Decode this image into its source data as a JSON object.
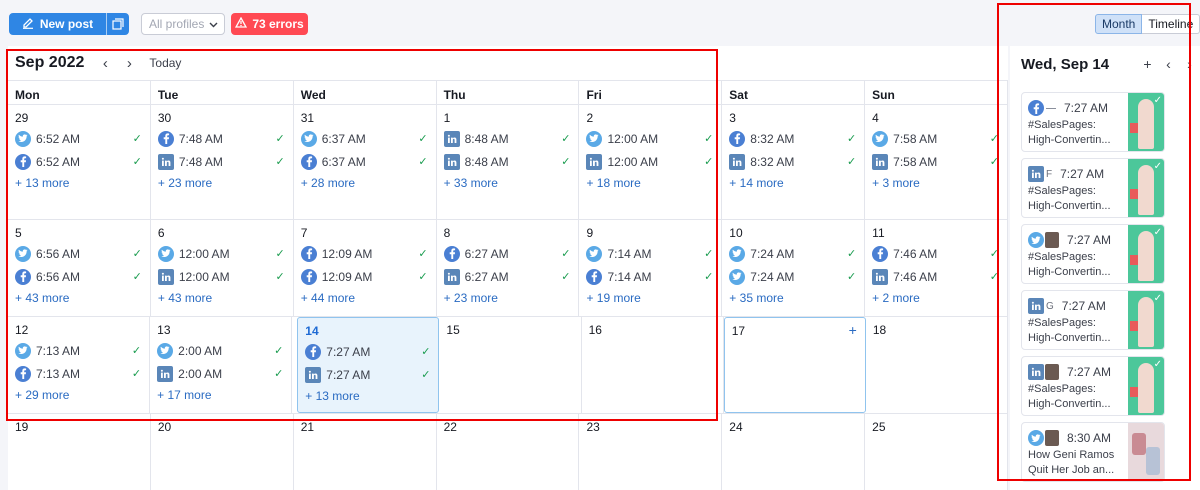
{
  "toolbar": {
    "new_post_label": "New post",
    "profiles_placeholder": "All profiles",
    "errors_label": "73 errors",
    "view_month": "Month",
    "view_timeline": "Timeline"
  },
  "calendar": {
    "month_title": "Sep 2022",
    "today_label": "Today",
    "weekdays": [
      "Mon",
      "Tue",
      "Wed",
      "Thu",
      "Fri",
      "Sat",
      "Sun"
    ],
    "weeks": [
      [
        {
          "day": "29",
          "posts": [
            {
              "icon": "twitter",
              "time": "6:52 AM"
            },
            {
              "icon": "facebook",
              "time": "6:52 AM"
            }
          ],
          "more": "+ 13 more"
        },
        {
          "day": "30",
          "posts": [
            {
              "icon": "facebook",
              "time": "7:48 AM"
            },
            {
              "icon": "linkedin",
              "time": "7:48 AM"
            }
          ],
          "more": "+ 23 more"
        },
        {
          "day": "31",
          "posts": [
            {
              "icon": "twitter",
              "time": "6:37 AM"
            },
            {
              "icon": "facebook",
              "time": "6:37 AM"
            }
          ],
          "more": "+ 28 more"
        },
        {
          "day": "1",
          "posts": [
            {
              "icon": "linkedin",
              "time": "8:48 AM"
            },
            {
              "icon": "linkedin",
              "time": "8:48 AM"
            }
          ],
          "more": "+ 33 more"
        },
        {
          "day": "2",
          "posts": [
            {
              "icon": "twitter",
              "time": "12:00 AM"
            },
            {
              "icon": "linkedin",
              "time": "12:00 AM"
            }
          ],
          "more": "+ 18 more"
        },
        {
          "day": "3",
          "posts": [
            {
              "icon": "facebook",
              "time": "8:32 AM"
            },
            {
              "icon": "linkedin",
              "time": "8:32 AM"
            }
          ],
          "more": "+ 14 more"
        },
        {
          "day": "4",
          "posts": [
            {
              "icon": "twitter",
              "time": "7:58 AM"
            },
            {
              "icon": "linkedin",
              "time": "7:58 AM"
            }
          ],
          "more": "+ 3 more"
        }
      ],
      [
        {
          "day": "5",
          "posts": [
            {
              "icon": "twitter",
              "time": "6:56 AM"
            },
            {
              "icon": "facebook",
              "time": "6:56 AM"
            }
          ],
          "more": "+ 43 more"
        },
        {
          "day": "6",
          "posts": [
            {
              "icon": "twitter",
              "time": "12:00 AM"
            },
            {
              "icon": "linkedin",
              "time": "12:00 AM"
            }
          ],
          "more": "+ 43 more"
        },
        {
          "day": "7",
          "posts": [
            {
              "icon": "facebook",
              "time": "12:09 AM"
            },
            {
              "icon": "facebook",
              "time": "12:09 AM"
            }
          ],
          "more": "+ 44 more"
        },
        {
          "day": "8",
          "posts": [
            {
              "icon": "facebook",
              "time": "6:27 AM"
            },
            {
              "icon": "linkedin",
              "time": "6:27 AM"
            }
          ],
          "more": "+ 23 more"
        },
        {
          "day": "9",
          "posts": [
            {
              "icon": "twitter",
              "time": "7:14 AM"
            },
            {
              "icon": "facebook",
              "time": "7:14 AM"
            }
          ],
          "more": "+ 19 more"
        },
        {
          "day": "10",
          "posts": [
            {
              "icon": "twitter",
              "time": "7:24 AM"
            },
            {
              "icon": "twitter",
              "time": "7:24 AM"
            }
          ],
          "more": "+ 35 more"
        },
        {
          "day": "11",
          "posts": [
            {
              "icon": "facebook",
              "time": "7:46 AM"
            },
            {
              "icon": "linkedin",
              "time": "7:46 AM"
            }
          ],
          "more": "+ 2 more"
        }
      ],
      [
        {
          "day": "12",
          "posts": [
            {
              "icon": "twitter",
              "time": "7:13 AM"
            },
            {
              "icon": "facebook",
              "time": "7:13 AM"
            }
          ],
          "more": "+ 29 more"
        },
        {
          "day": "13",
          "posts": [
            {
              "icon": "twitter",
              "time": "2:00 AM"
            },
            {
              "icon": "linkedin",
              "time": "2:00 AM"
            }
          ],
          "more": "+ 17 more"
        },
        {
          "day": "14",
          "posts": [
            {
              "icon": "facebook",
              "time": "7:27 AM"
            },
            {
              "icon": "linkedin",
              "time": "7:27 AM"
            }
          ],
          "more": "+ 13 more",
          "today": true
        },
        {
          "day": "15",
          "posts": [],
          "more": ""
        },
        {
          "day": "16",
          "posts": [],
          "more": ""
        },
        {
          "day": "17",
          "posts": [],
          "more": "",
          "hover": true
        },
        {
          "day": "18",
          "posts": [],
          "more": ""
        }
      ],
      [
        {
          "day": "19",
          "posts": [],
          "more": ""
        },
        {
          "day": "20",
          "posts": [],
          "more": ""
        },
        {
          "day": "21",
          "posts": [],
          "more": ""
        },
        {
          "day": "22",
          "posts": [],
          "more": ""
        },
        {
          "day": "23",
          "posts": [],
          "more": ""
        },
        {
          "day": "24",
          "posts": [],
          "more": ""
        },
        {
          "day": "25",
          "posts": [],
          "more": ""
        }
      ]
    ]
  },
  "day_panel": {
    "title": "Wed, Sep 14",
    "posts": [
      {
        "icon": "facebook",
        "extra": "dash",
        "time": "7:27 AM",
        "line1": "#SalesPages:",
        "line2": "High-Convertin...",
        "thumb": "green"
      },
      {
        "icon": "linkedin",
        "extra": "F",
        "time": "7:27 AM",
        "line1": "#SalesPages:",
        "line2": "High-Convertin...",
        "thumb": "green"
      },
      {
        "icon": "twitter",
        "extra": "avatar",
        "time": "7:27 AM",
        "line1": "#SalesPages:",
        "line2": "High-Convertin...",
        "thumb": "green"
      },
      {
        "icon": "linkedin",
        "extra": "G",
        "time": "7:27 AM",
        "line1": "#SalesPages:",
        "line2": "High-Convertin...",
        "thumb": "green"
      },
      {
        "icon": "linkedin",
        "extra": "avatar",
        "time": "7:27 AM",
        "line1": "#SalesPages:",
        "line2": "High-Convertin...",
        "thumb": "green"
      },
      {
        "icon": "twitter",
        "extra": "avatar",
        "time": "8:30 AM",
        "line1": "How Geni Ramos",
        "line2": "Quit Her Job an...",
        "thumb": "photo"
      }
    ]
  }
}
